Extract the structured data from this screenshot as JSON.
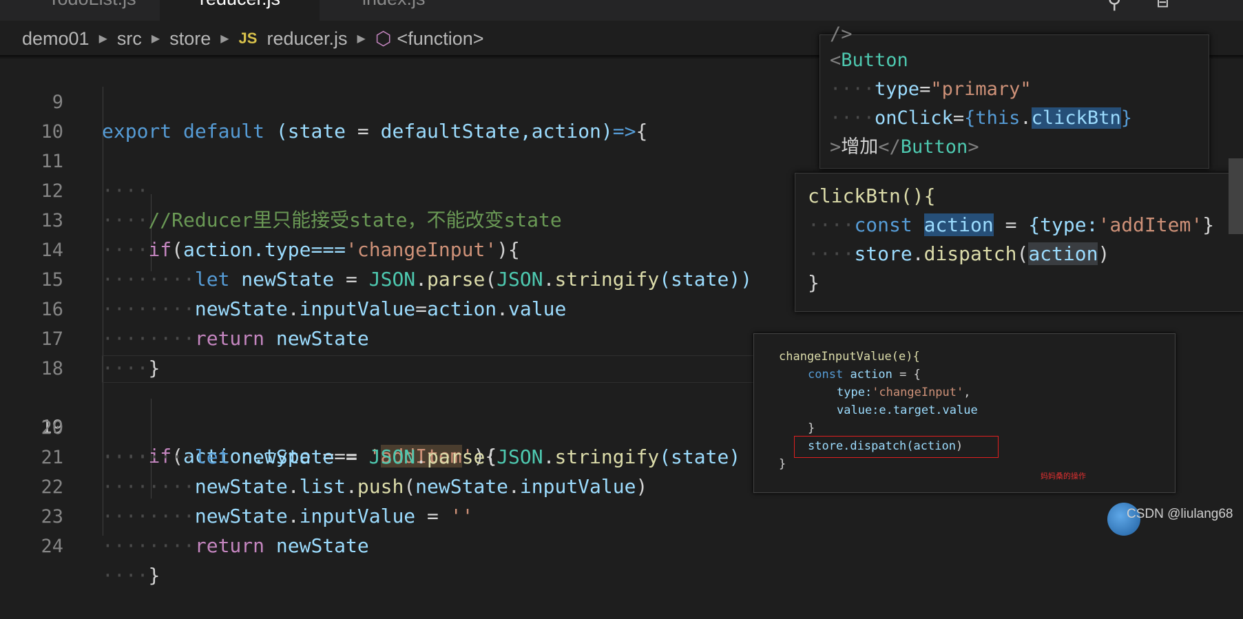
{
  "tabs": [
    {
      "label": "TodoList.js"
    },
    {
      "label": "reducer.js",
      "active": true
    },
    {
      "label": "index.js"
    }
  ],
  "breadcrumb": {
    "items": [
      "demo01",
      "src",
      "store"
    ],
    "file_badge": "JS",
    "file": "reducer.js",
    "symbol": "<function>"
  },
  "code": {
    "line_numbers": [
      "9",
      "10",
      "11",
      "12",
      "13",
      "14",
      "15",
      "16",
      "17",
      "18",
      "19",
      "20",
      "21",
      "22",
      "23",
      "24"
    ],
    "current_line": "19",
    "lines": {
      "l9": {
        "a": "export",
        "b": "default",
        "c": "(state",
        "d": "=",
        "e": "defaultState,action)",
        "f": "=>",
        "g": "{"
      },
      "l12": "//Reducer里只能接受state，不能改变state",
      "l13": {
        "a": "if",
        "b": "(",
        "c": "action",
        "d": ".type===",
        "e": "'changeInput'",
        "f": "){"
      },
      "l14": {
        "a": "let",
        "b": "newState",
        "c": "=",
        "d": "JSON",
        "e": ".",
        "f": "parse",
        "g": "(",
        "h": "JSON",
        "i": ".",
        "j": "stringify",
        "k": "(state))"
      },
      "l15": {
        "a": "newState",
        "b": ".",
        "c": "inputValue",
        "d": "=",
        "e": "action",
        "f": ".",
        "g": "value"
      },
      "l16": {
        "a": "return",
        "b": "newState"
      },
      "l17": "}",
      "l19": {
        "a": "if",
        "b": "(",
        "c": "action",
        "d": ".type",
        "e": "===",
        "f": "'",
        "g": "addItem",
        "h": "'",
        "i": "){"
      },
      "l20": {
        "a": "let",
        "b": "newState",
        "c": "=",
        "d": "JSON",
        "e": ".",
        "f": "parse",
        "g": "(",
        "h": "JSON",
        "i": ".",
        "j": "stringify",
        "k": "(state)"
      },
      "l21": {
        "a": "newState",
        "b": ".",
        "c": "list",
        "d": ".",
        "e": "push",
        "f": "(",
        "g": "newState",
        "h": ".",
        "i": "inputValue",
        "j": ")"
      },
      "l22": {
        "a": "newState",
        "b": ".",
        "c": "inputValue",
        "d": "=",
        "e": "''"
      },
      "l23": {
        "a": "return",
        "b": "newState"
      },
      "l24": "}"
    }
  },
  "popup_button": {
    "l0": "/>",
    "l1a": "<",
    "l1b": "Button",
    "l2a": "type",
    "l2b": "=",
    "l2c": "\"primary\"",
    "l3a": "onClick",
    "l3b": "=",
    "l3c": "{",
    "l3d": "this",
    "l3e": ".",
    "l3f": "clickBtn",
    "l3g": "}",
    "l4a": ">",
    "l4b": "增加",
    "l4c": "</",
    "l4d": "Button",
    "l4e": ">"
  },
  "popup_clickbtn": {
    "l1": "clickBtn(){",
    "l2a": "const",
    "l2b": "action",
    "l2c": "=",
    "l2d": "{type:",
    "l2e": "'addItem'",
    "l2f": "}",
    "l3a": "store",
    "l3b": ".",
    "l3c": "dispatch",
    "l3d": "(",
    "l3e": "action",
    "l3f": ")",
    "l4": "}"
  },
  "popup_change": {
    "l1": "changeInputValue(e){",
    "l2a": "const",
    "l2b": "action",
    "l2c": "= {",
    "l3a": "type:",
    "l3b": "'changeInput'",
    "l3c": ",",
    "l4a": "value:",
    "l4b": "e.target.value",
    "l5": "}",
    "l6a": "store.dispatch(",
    "l6b": "action",
    "l6c": ")",
    "l7": "}",
    "note": "妈妈桑的操作"
  },
  "watermark": "CSDN @liulang68",
  "colors": {
    "keyword": "#569cd6",
    "control": "#c586c0",
    "string": "#ce9178",
    "variable": "#9cdcfe",
    "function": "#dcdcaa",
    "comment": "#6a9955",
    "class": "#4ec9b0",
    "background": "#1e1e1e"
  }
}
